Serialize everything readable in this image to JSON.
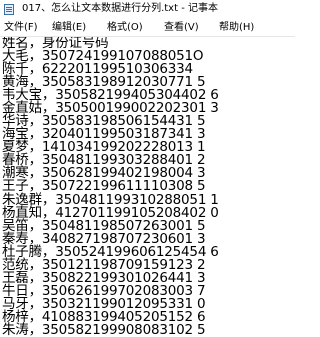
{
  "window": {
    "title": "017、怎么让文本数据进行分列.txt - 记事本"
  },
  "menu": [
    {
      "label": "文件(F)"
    },
    {
      "label": "编辑(E)"
    },
    {
      "label": "格式(O)"
    },
    {
      "label": "查看(V)"
    },
    {
      "label": "帮助(H)"
    }
  ],
  "editor": {
    "lines": [
      "姓名，身份证号码",
      "大毛，350724199107088051O",
      "陈千，622201199510306334",
      "黄海，350583198912030771 5",
      "韦大宝，350582199405304402 6",
      "金直姑，350500199002202301 3",
      "华诗，350583198506154431 5",
      "海宝，320401199503187341 3",
      "夏梦，141034199202228013 1",
      "春桥，350481199303288401 2",
      "潮寒，350628199402198004 3",
      "王子，350722199611110308 5",
      "朱逸群，350481199310288051 1",
      "杨直知，412701199105208402 0",
      "吴笛，350481198507263001 5",
      "秦寿，340827198707230601 3",
      "杜子腾，350524199606125454 6",
      "范统，350121198709159123 2",
      "王磊，350822199301026441 3",
      "牛日，350626199702083003 7",
      "马牙，350321199012095331 0",
      "杨梓，410883199405205152 6",
      "朱涛，350582199908083102 5"
    ]
  }
}
